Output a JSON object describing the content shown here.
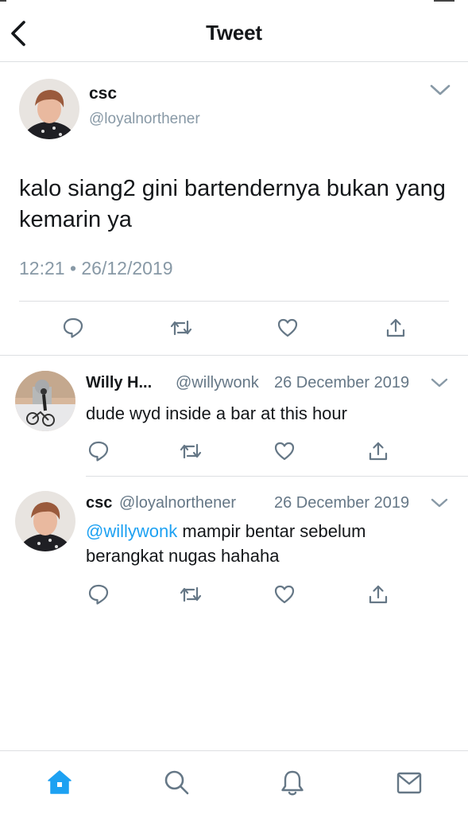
{
  "header": {
    "title": "Tweet"
  },
  "colors": {
    "accent": "#1da1f2",
    "muted": "#8899a6",
    "text": "#14171a",
    "divider": "#dddfe2"
  },
  "main_tweet": {
    "name": "csc",
    "handle": "@loyalnorthener",
    "text": "kalo siang2 gini bartendernya bukan yang kemarin ya",
    "timestamp": "12:21 • 26/12/2019",
    "actions": [
      "reply-icon",
      "retweet-icon",
      "like-icon",
      "share-icon"
    ]
  },
  "replies": [
    {
      "name": "Willy H...",
      "handle": "@willywonk",
      "date": "26 December 2019",
      "text": "dude wyd inside a bar at this hour",
      "mention": ""
    },
    {
      "name": "csc",
      "handle": "@loyalnorthener",
      "date": "26 December 2019",
      "mention": "@willywonk",
      "text": " mampir bentar sebelum berangkat nugas hahaha"
    }
  ],
  "tabbar": {
    "items": [
      "home-icon",
      "search-icon",
      "notifications-icon",
      "messages-icon"
    ],
    "active": "home-icon"
  }
}
